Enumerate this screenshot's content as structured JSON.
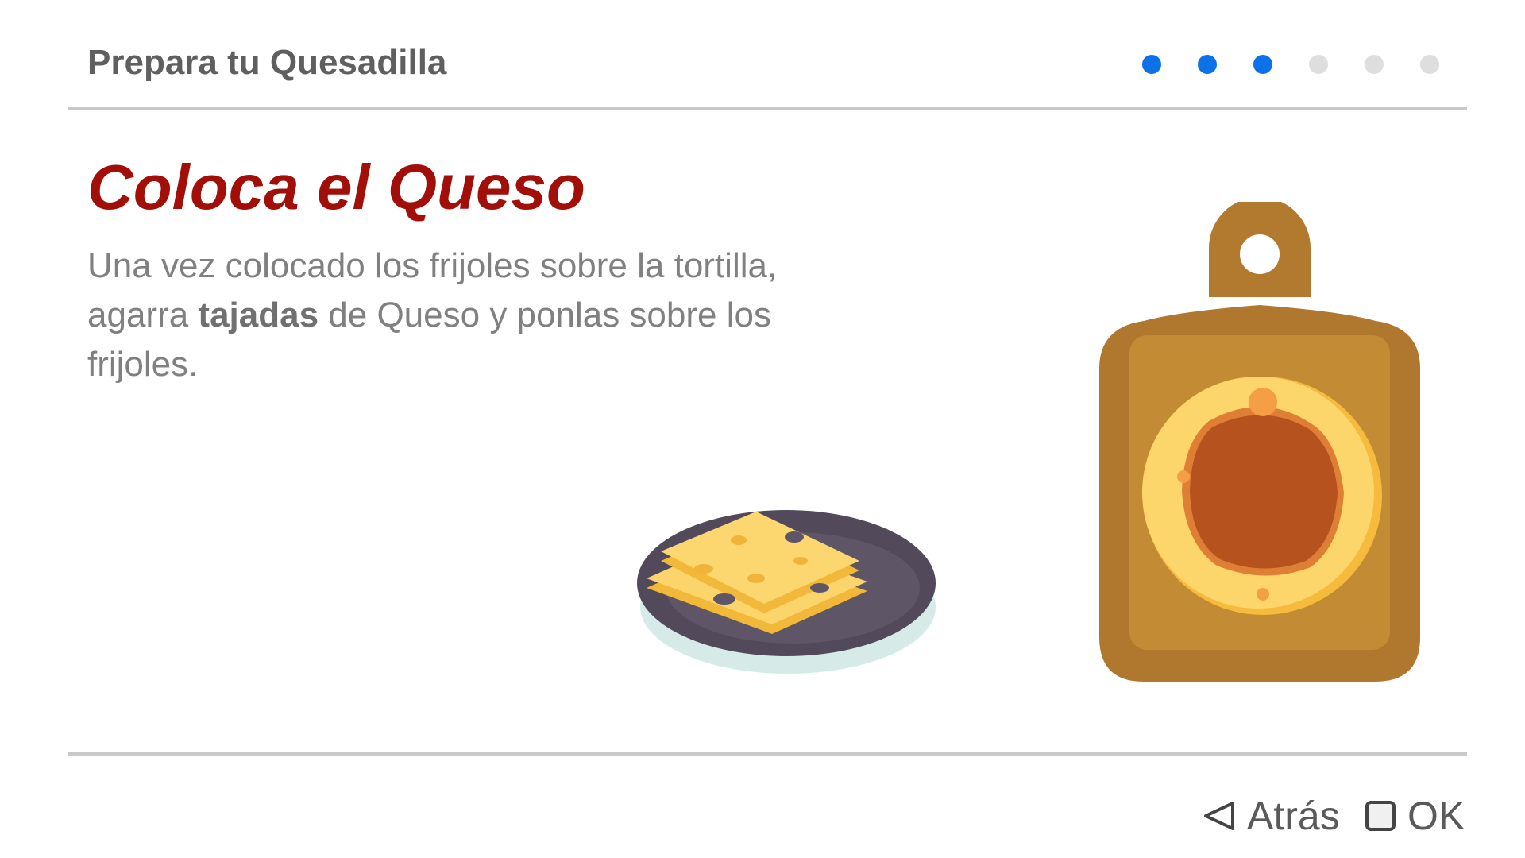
{
  "header": {
    "title": "Prepara tu Quesadilla",
    "progress": {
      "total_steps": 6,
      "completed_steps": 3,
      "active_color": "#0b72e7",
      "inactive_color": "#dedede"
    }
  },
  "step": {
    "title": "Coloca el Queso",
    "instruction_part1": "Una vez colocado los frijoles sobre la tortilla, agarra ",
    "instruction_bold": "tajadas",
    "instruction_part2": " de Queso y ponlas sobre los frijoles.",
    "title_color": "#a10f08"
  },
  "illustrations": {
    "plate": "cheese-slices-plate",
    "board": "cutting-board-with-tortilla-and-beans"
  },
  "footer": {
    "back_label": "Atrás",
    "back_icon": "triangle-left-icon",
    "ok_label": "OK",
    "ok_icon": "square-icon"
  }
}
